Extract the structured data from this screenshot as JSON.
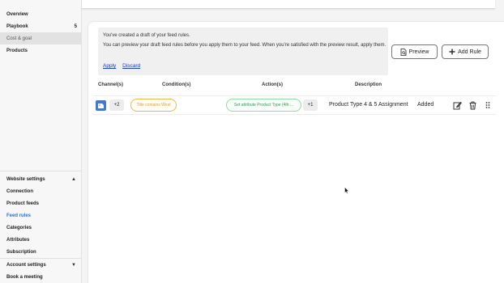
{
  "sidebar": {
    "items": [
      {
        "label": "Overview"
      },
      {
        "label": "Playbook",
        "count": "5"
      },
      {
        "label": "Cost & goal"
      },
      {
        "label": "Products"
      }
    ],
    "website_settings": {
      "title": "Website settings",
      "items": [
        {
          "label": "Connection"
        },
        {
          "label": "Product feeds"
        },
        {
          "label": "Feed rules"
        },
        {
          "label": "Categories"
        },
        {
          "label": "Attributes"
        },
        {
          "label": "Subscription"
        }
      ]
    },
    "account_settings": {
      "title": "Account settings",
      "items": [
        {
          "label": "Book a meeting"
        }
      ]
    }
  },
  "notice": {
    "line1": "You've created a draft of your feed rules.",
    "line2": "You can preview your draft feed rules before you apply them to your feed. When you're satisfied with the preview result, apply them.",
    "apply_label": "Apply",
    "discard_label": "Discard"
  },
  "buttons": {
    "preview_label": "Preview",
    "add_rule_label": "Add Rule"
  },
  "table": {
    "headers": {
      "channels": "Channel(s)",
      "conditions": "Condition(s)",
      "actions": "Action(s)",
      "description": "Description"
    },
    "rows": [
      {
        "channel_extra": "+2",
        "condition": "Title contains Wool",
        "action": "Set attribute Product Type (4th ...",
        "action_extra": "+1",
        "description": "Product Type 4 & 5 Assignment",
        "status": "Added"
      }
    ]
  },
  "colors": {
    "link": "#2f6fd6",
    "condition_pill": "#d9a23a",
    "action_pill": "#3a9a55",
    "channel_icon": "#4a78c2"
  },
  "icons": [
    "google-shopping-icon",
    "document-search-icon",
    "plus-icon",
    "edit-icon",
    "trash-icon",
    "drag-handle-icon",
    "chevron-up-icon",
    "chevron-down-icon"
  ]
}
